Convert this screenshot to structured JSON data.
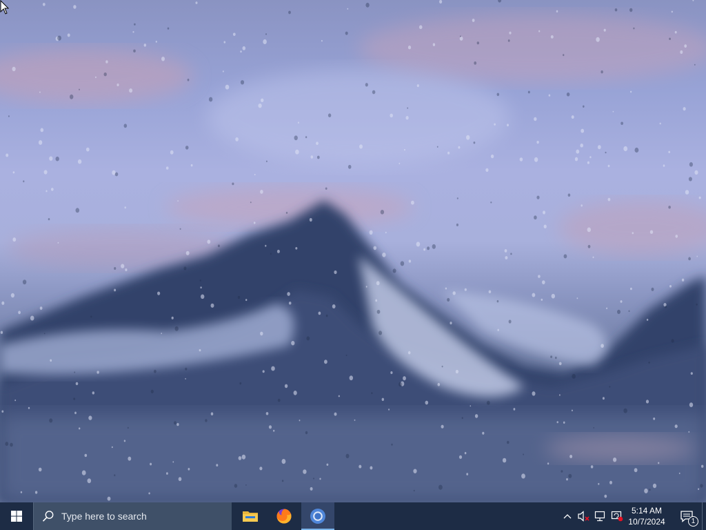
{
  "desktop": {
    "wallpaper": "rainy-mountain-wallpaper",
    "colors": {
      "sky": "#a8b0dc",
      "mountain": "#2d3e63",
      "cloud": "#d3d8ee",
      "pink": "#c9a2b8"
    }
  },
  "taskbar": {
    "background": "#1d2c45",
    "start": {
      "icon": "windows-logo-icon"
    },
    "search": {
      "placeholder": "Type here to search",
      "icon": "search-icon"
    },
    "apps": [
      {
        "name": "File Explorer",
        "icon": "folder-icon",
        "active": false
      },
      {
        "name": "Firefox",
        "icon": "firefox-icon",
        "active": false
      },
      {
        "name": "Chrome",
        "icon": "chrome-icon",
        "active": true
      }
    ],
    "tray": {
      "icons": [
        "chevron-up-icon",
        "volume-muted-icon",
        "network-icon",
        "update-alert-icon"
      ],
      "time": "5:14 AM",
      "date": "10/7/2024",
      "notifications": {
        "icon": "notification-icon",
        "count": "1"
      }
    }
  }
}
